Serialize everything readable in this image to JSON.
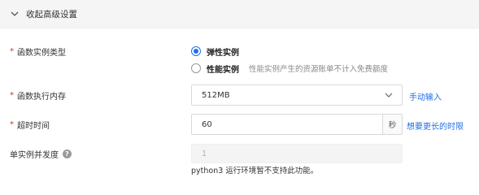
{
  "collapse_bar": {
    "title": "收起高级设置",
    "icon": "chevron-down-icon"
  },
  "fields": {
    "instance_type": {
      "label": "函数实例类型",
      "required": "*",
      "options": [
        {
          "label": "弹性实例",
          "selected": true,
          "hint": ""
        },
        {
          "label": "性能实例",
          "selected": false,
          "hint": "性能实例产生的资源账单不计入免费额度"
        }
      ]
    },
    "memory": {
      "label": "函数执行内存",
      "required": "*",
      "value": "512MB",
      "link": "手动输入"
    },
    "timeout": {
      "label": "超时时间",
      "required": "*",
      "value": "60",
      "unit": "秒",
      "link": "想要更长的时限"
    },
    "concurrency": {
      "label": "单实例并发度",
      "help_icon": "?",
      "value": "1",
      "note": "python3 运行环境暂不支持此功能。"
    }
  },
  "colors": {
    "accent": "#1f6feb",
    "required": "#d93026"
  }
}
